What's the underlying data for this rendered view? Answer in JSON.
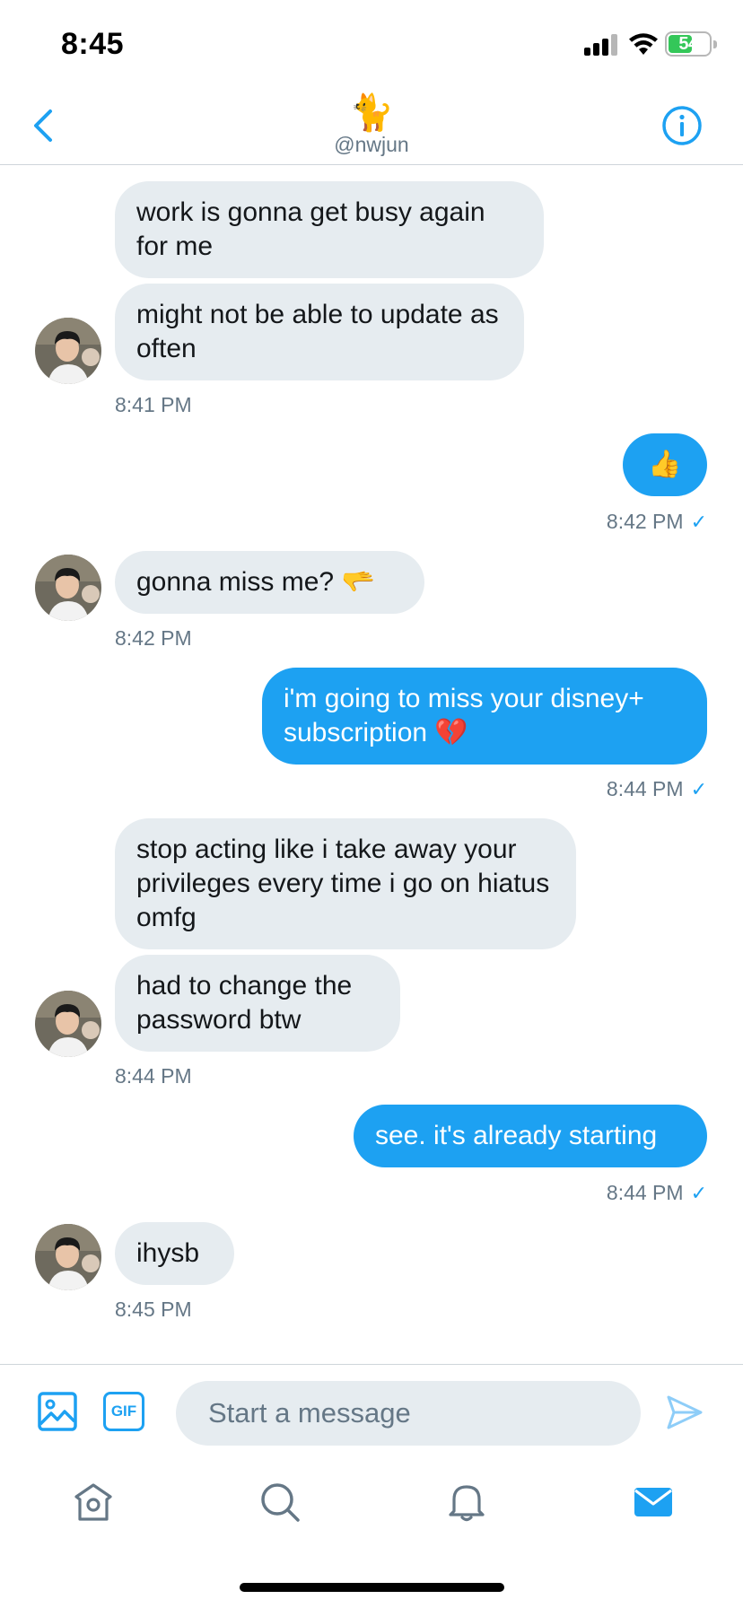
{
  "status_bar": {
    "time": "8:45",
    "battery": "54"
  },
  "header": {
    "emoji": "🐈",
    "handle": "@nwjun"
  },
  "messages": [
    {
      "text": "work is gonna get busy again for me"
    },
    {
      "text": "might not be able to update as often"
    },
    {
      "time": "8:41 PM"
    },
    {
      "text": "👍"
    },
    {
      "time": "8:42 PM"
    },
    {
      "text": "gonna miss me? 🫳"
    },
    {
      "time": "8:42 PM"
    },
    {
      "text": "i'm going to miss your disney+ subscription 💔"
    },
    {
      "time": "8:44 PM"
    },
    {
      "text": "stop acting like i take away your privileges every time i go on hiatus omfg"
    },
    {
      "text": "had to change the password btw"
    },
    {
      "time": "8:44 PM"
    },
    {
      "text": "see. it's already starting"
    },
    {
      "time": "8:44 PM"
    },
    {
      "text": "ihysb"
    },
    {
      "time": "8:45 PM"
    }
  ],
  "read_check": "✓",
  "composer": {
    "placeholder": "Start a message",
    "gif_label": "GIF"
  },
  "colors": {
    "accent": "#1da1f2",
    "incoming_bubble": "#e6ecf0",
    "secondary_text": "#657786"
  }
}
